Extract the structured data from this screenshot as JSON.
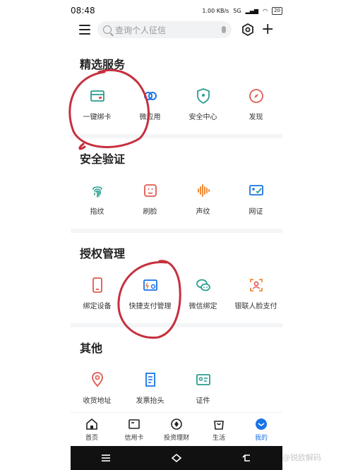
{
  "status": {
    "time": "08:48",
    "net_speed": "1.00 KB/s",
    "signal": "5G",
    "battery": "20"
  },
  "search": {
    "placeholder": "查询个人征信"
  },
  "sections": [
    {
      "title": "精选服务",
      "items": [
        {
          "label": "一键绑卡",
          "icon": "card-icon"
        },
        {
          "label": "微应用",
          "icon": "link-icon"
        },
        {
          "label": "安全中心",
          "icon": "shield-icon"
        },
        {
          "label": "发现",
          "icon": "compass-icon"
        }
      ]
    },
    {
      "title": "安全验证",
      "items": [
        {
          "label": "指纹",
          "icon": "fingerprint-icon"
        },
        {
          "label": "刷脸",
          "icon": "face-icon"
        },
        {
          "label": "声纹",
          "icon": "voiceprint-icon"
        },
        {
          "label": "网证",
          "icon": "id-cert-icon"
        }
      ]
    },
    {
      "title": "授权管理",
      "items": [
        {
          "label": "绑定设备",
          "icon": "device-icon"
        },
        {
          "label": "快捷支付管理",
          "icon": "quick-pay-icon"
        },
        {
          "label": "微信绑定",
          "icon": "wechat-icon"
        },
        {
          "label": "银联人脸支付",
          "icon": "face-pay-icon"
        }
      ]
    },
    {
      "title": "其他",
      "items": [
        {
          "label": "收货地址",
          "icon": "location-icon"
        },
        {
          "label": "发票抬头",
          "icon": "invoice-icon"
        },
        {
          "label": "证件",
          "icon": "id-card-icon"
        }
      ]
    }
  ],
  "tabs": [
    {
      "label": "首页",
      "icon": "home-icon"
    },
    {
      "label": "信用卡",
      "icon": "credit-card-icon"
    },
    {
      "label": "投资理财",
      "icon": "invest-icon"
    },
    {
      "label": "生活",
      "icon": "life-icon"
    },
    {
      "label": "我的",
      "icon": "profile-icon",
      "active": true
    }
  ],
  "watermark": "@锐欧解码",
  "colors": {
    "accent": "#1a73e8",
    "annotation": "#c5303e",
    "bg": "#f4f5f7"
  }
}
